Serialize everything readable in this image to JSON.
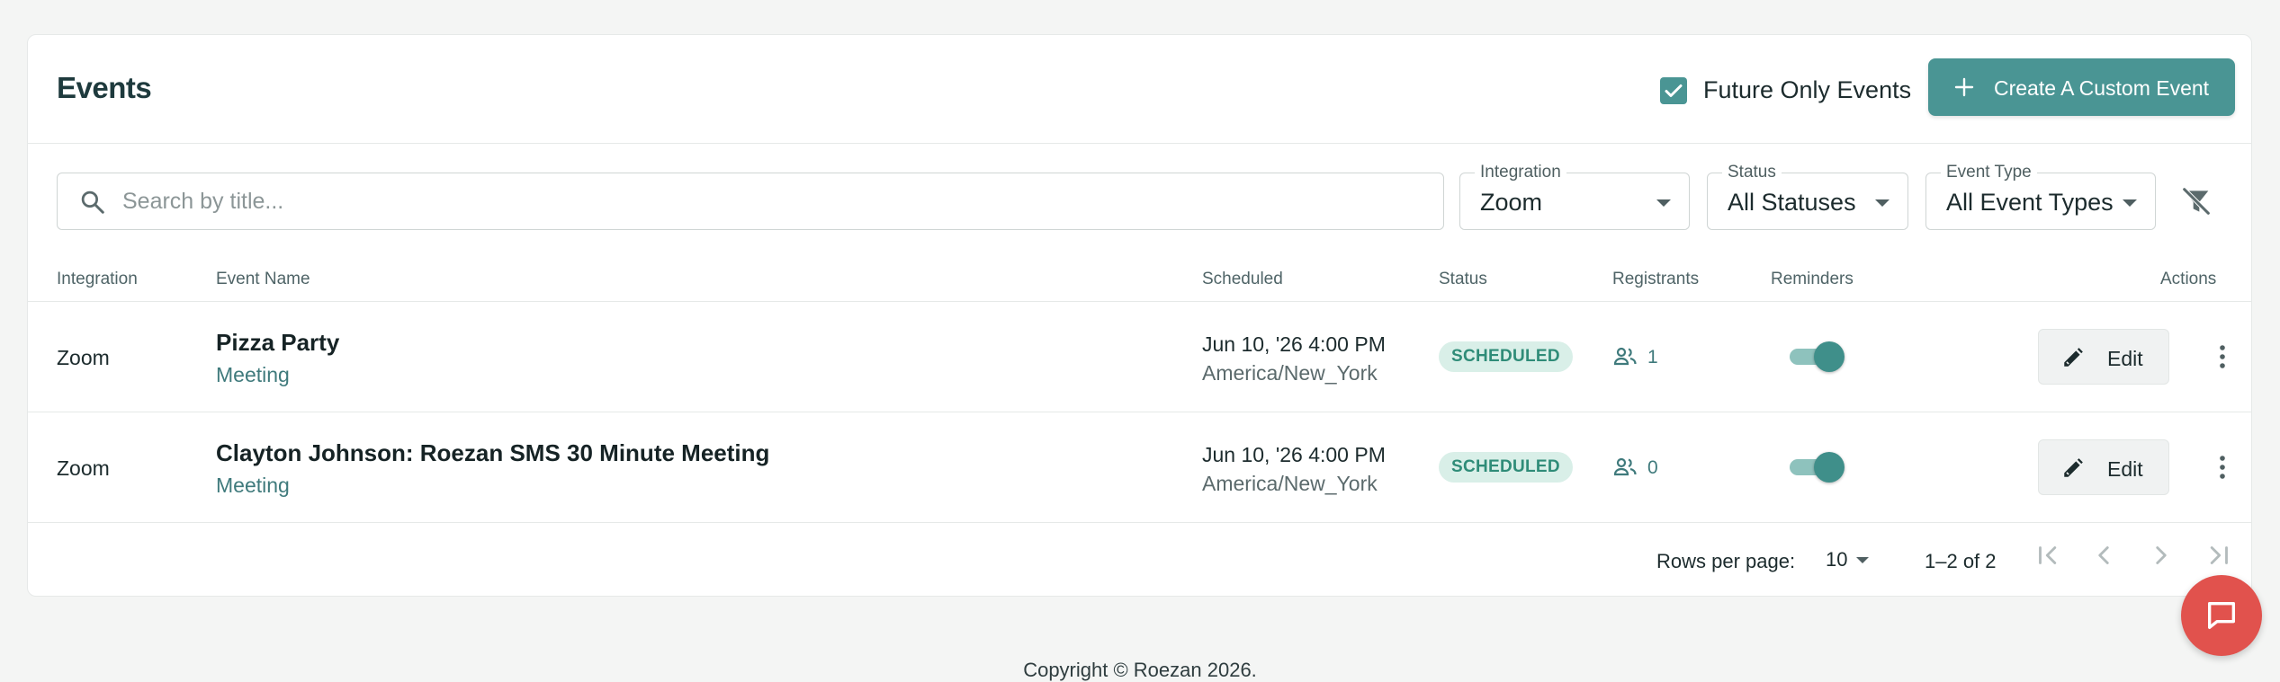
{
  "header": {
    "title": "Events",
    "future_only_label": "Future Only Events",
    "future_only_checked": true,
    "create_button_label": "Create A Custom Event"
  },
  "filters": {
    "search_placeholder": "Search by title...",
    "integration": {
      "label": "Integration",
      "value": "Zoom"
    },
    "status": {
      "label": "Status",
      "value": "All Statuses"
    },
    "event_type": {
      "label": "Event Type",
      "value": "All Event Types"
    }
  },
  "table": {
    "columns": {
      "integration": "Integration",
      "event_name": "Event Name",
      "scheduled": "Scheduled",
      "status": "Status",
      "registrants": "Registrants",
      "reminders": "Reminders",
      "actions": "Actions"
    },
    "rows": [
      {
        "integration": "Zoom",
        "name": "Pizza Party",
        "type": "Meeting",
        "date": "Jun 10, '26 4:00 PM",
        "timezone": "America/New_York",
        "status": "SCHEDULED",
        "registrants": "1",
        "reminders_on": true,
        "edit_label": "Edit"
      },
      {
        "integration": "Zoom",
        "name": "Clayton Johnson: Roezan SMS 30 Minute Meeting",
        "type": "Meeting",
        "date": "Jun 10, '26 4:00 PM",
        "timezone": "America/New_York",
        "status": "SCHEDULED",
        "registrants": "0",
        "reminders_on": true,
        "edit_label": "Edit"
      }
    ]
  },
  "pagination": {
    "rows_per_page_label": "Rows per page:",
    "rows_per_page": "10",
    "range": "1–2 of 2"
  },
  "footer": {
    "copyright": "Copyright © Roezan 2026."
  },
  "colors": {
    "accent": "#4a9594",
    "badge_bg": "#d9efe8",
    "badge_text": "#2f8c78",
    "chat": "#e1524d"
  },
  "icons": [
    "check-icon",
    "plus-icon",
    "search-icon",
    "filter-off-icon",
    "people-icon",
    "pencil-icon",
    "more-vert-icon",
    "first-page-icon",
    "chevron-left-icon",
    "chevron-right-icon",
    "last-page-icon",
    "chat-icon"
  ]
}
